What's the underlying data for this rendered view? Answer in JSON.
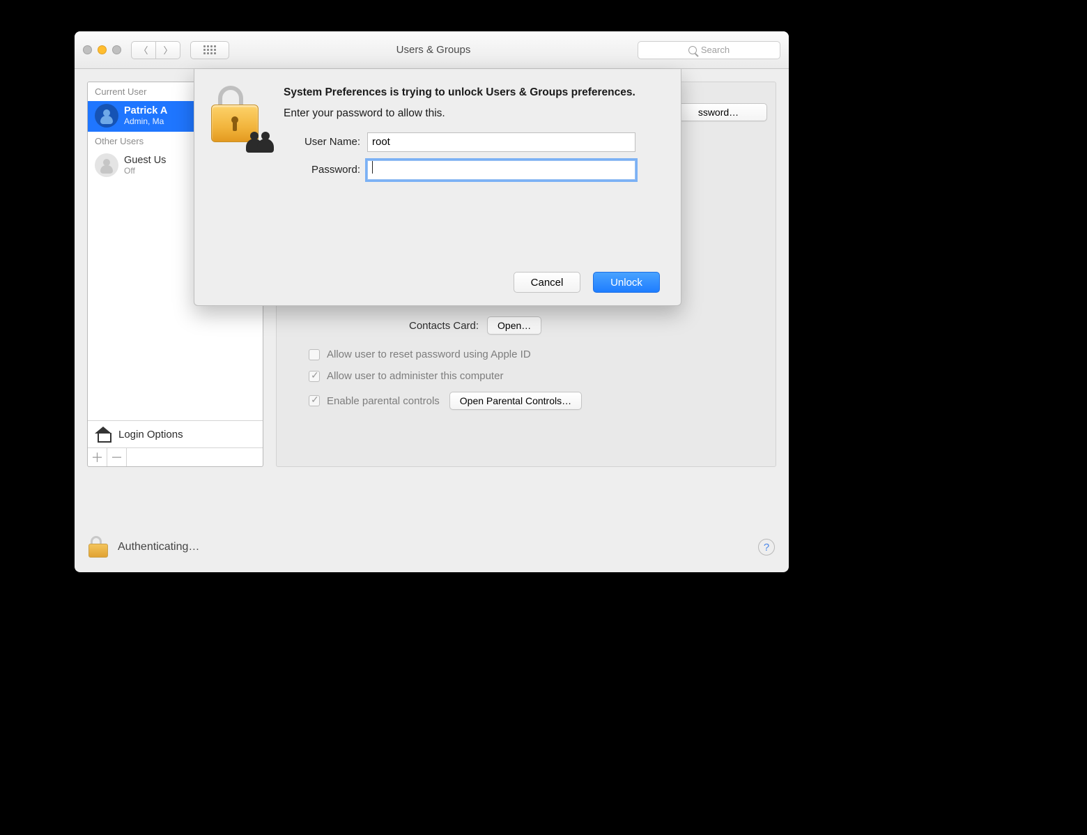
{
  "window": {
    "title": "Users & Groups",
    "search_placeholder": "Search"
  },
  "sidebar": {
    "section_current": "Current User",
    "section_other": "Other Users",
    "current_user": {
      "name": "Patrick A",
      "subtitle": "Admin, Ma"
    },
    "guest_user": {
      "name": "Guest Us",
      "subtitle": "Off"
    },
    "login_options_label": "Login Options"
  },
  "main": {
    "change_password_button": "ssword…",
    "contacts_card_label": "Contacts Card:",
    "contacts_open_button": "Open…",
    "checkbox_reset_apple_id": "Allow user to reset password using Apple ID",
    "checkbox_admin": "Allow user to administer this computer",
    "checkbox_parental": "Enable parental controls",
    "open_parental_button": "Open Parental Controls…"
  },
  "footer": {
    "status_text": "Authenticating…"
  },
  "dialog": {
    "heading": "System Preferences is trying to unlock Users & Groups preferences.",
    "subheading": "Enter your password to allow this.",
    "username_label": "User Name:",
    "username_value": "root",
    "password_label": "Password:",
    "password_value": "",
    "cancel_button": "Cancel",
    "unlock_button": "Unlock"
  }
}
